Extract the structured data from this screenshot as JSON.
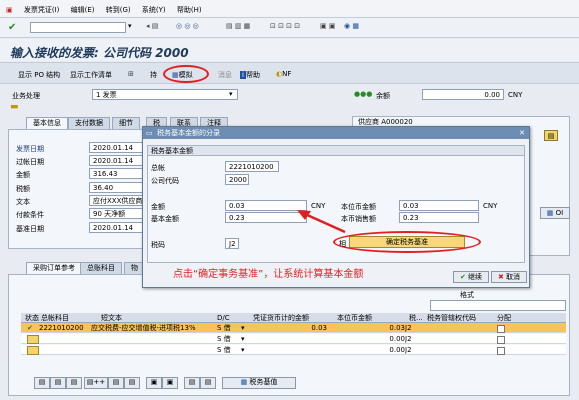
{
  "menubar": {
    "items": [
      "发票凭证(I)",
      "编辑(E)",
      "转到(G)",
      "系统(Y)",
      "帮助(H)"
    ]
  },
  "header": {
    "title": "输入接收的发票: 公司代码 2000"
  },
  "toolbar": {
    "show_po": "显示 PO 结构",
    "show_worklist": "显示工作清单",
    "hold": "持",
    "simulate": "模拟",
    "messages": "消息",
    "help": "帮助",
    "nf": "NF"
  },
  "form": {
    "transaction_label": "业务处理",
    "transaction_value": "1 发票",
    "balance_label": "余额",
    "balance_value": "0.00",
    "balance_currency": "CNY",
    "vendor_label": "供应商 A000020"
  },
  "tabs": [
    "基本信息",
    "支付数据",
    "细节",
    "税",
    "联系",
    "注释"
  ],
  "basic": {
    "invoice_date_label": "发票日期",
    "invoice_date": "2020.01.14",
    "posting_date_label": "过帐日期",
    "posting_date": "2020.01.14",
    "amount_label": "金额",
    "amount": "316.43",
    "tax_label": "税额",
    "tax": "36.40",
    "text_label": "文本",
    "text": "应付XXX供应商",
    "terms_label": "付款条件",
    "terms": "90 天净额",
    "baseline_label": "基准日期",
    "baseline": "2020.01.14"
  },
  "bottom_tabs": [
    "采购订单参考",
    "总账科目",
    "物"
  ],
  "dialog": {
    "title": "税务基本金额的分录",
    "group_title": "税务基本金额",
    "gl_label": "总帐",
    "gl_value": "2221010200",
    "company_label": "公司代码",
    "company_value": "2000",
    "amount_label": "金额",
    "amount_value": "0.03",
    "amount_currency": "CNY",
    "local_amount_label": "本位币金额",
    "local_amount_value": "0.03",
    "local_currency": "CNY",
    "base_label": "基本金额",
    "base_value": "0.23",
    "local_sales_label": "本币销售额",
    "local_sales_value": "0.23",
    "tax_code_label": "税码",
    "tax_code_value": "J2",
    "determine_prefix": "相",
    "determine_button": "确定税务基准",
    "continue_button": "继续",
    "cancel_button": "取消"
  },
  "annotation": "点击“确定事务基准”，让系统计算基本金额",
  "grid": {
    "format_label": "格式",
    "headers": [
      "状态",
      "总帐科目",
      "短文本",
      "D/C",
      "凭证货币计的金额",
      "本位币金额",
      "税...",
      "税务管辖权代码",
      "分配"
    ],
    "rows": [
      {
        "status": "✔",
        "account": "2221010200",
        "text": "应交税费-应交增值税-进项税13%",
        "dc": "S 借",
        "amount": "0.03",
        "local": "0.03",
        "tax": "J2"
      },
      {
        "status": "",
        "account": "",
        "text": "",
        "dc": "S 借",
        "amount": "",
        "local": "0.00",
        "tax": "J2"
      },
      {
        "status": "",
        "account": "",
        "text": "",
        "dc": "S 借",
        "amount": "",
        "local": "0.00",
        "tax": "J2"
      }
    ],
    "tax_base_button": "税务基值"
  },
  "right_button": "OI",
  "colors": {
    "accent_red": "#e02020",
    "dialog_title": "#6d8db2",
    "highlight_row": "#f7c45a"
  }
}
